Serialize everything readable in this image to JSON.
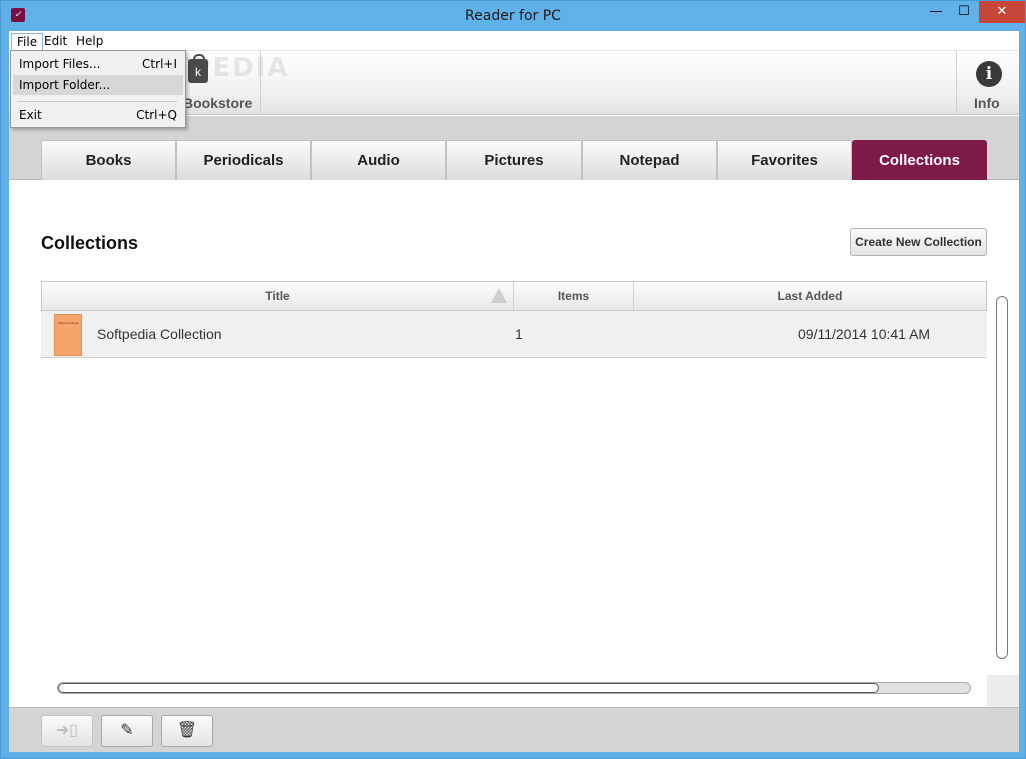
{
  "window": {
    "title": "Reader for PC",
    "controls": {
      "minimize": "—",
      "maximize": "☐",
      "close": "✕"
    },
    "colors": {
      "frame": "#5fb1e8",
      "close": "#c7463a"
    }
  },
  "menubar": {
    "items": [
      "File",
      "Edit",
      "Help"
    ]
  },
  "file_menu": {
    "items": [
      {
        "label": "Import Files...",
        "shortcut": "Ctrl+I"
      },
      {
        "label": "Import Folder...",
        "shortcut": ""
      },
      {
        "label": "Exit",
        "shortcut": "Ctrl+Q"
      }
    ]
  },
  "toolbar": {
    "bookstore_label": "Bookstore",
    "bookstore_icon": "shopping-bag-icon",
    "bookstore_glyph": "k",
    "info_label": "Info",
    "info_glyph": "i",
    "watermark": "SOFTPEDIA"
  },
  "tabs": [
    {
      "label": "Books"
    },
    {
      "label": "Periodicals"
    },
    {
      "label": "Audio"
    },
    {
      "label": "Pictures"
    },
    {
      "label": "Notepad"
    },
    {
      "label": "Favorites"
    },
    {
      "label": "Collections",
      "active": true
    }
  ],
  "accent_color": "#7e1a46",
  "main": {
    "heading": "Collections",
    "create_button": "Create New Collection",
    "columns": {
      "title": "Title",
      "items": "Items",
      "last_added": "Last Added"
    },
    "rows": [
      {
        "title": "Softpedia Collection",
        "items": "1",
        "last_added": "09/11/2014 10:41 AM",
        "thumb_text": "Softpedia Book"
      }
    ],
    "horizontal_scroll_fraction": 0.9
  },
  "bottom_buttons": [
    {
      "icon": "send-to-device-icon",
      "glyph": "➜▯",
      "disabled": true
    },
    {
      "icon": "edit-pencil-icon",
      "glyph": "✎",
      "disabled": false
    },
    {
      "icon": "trash-icon",
      "glyph": "🗑",
      "disabled": false
    }
  ]
}
